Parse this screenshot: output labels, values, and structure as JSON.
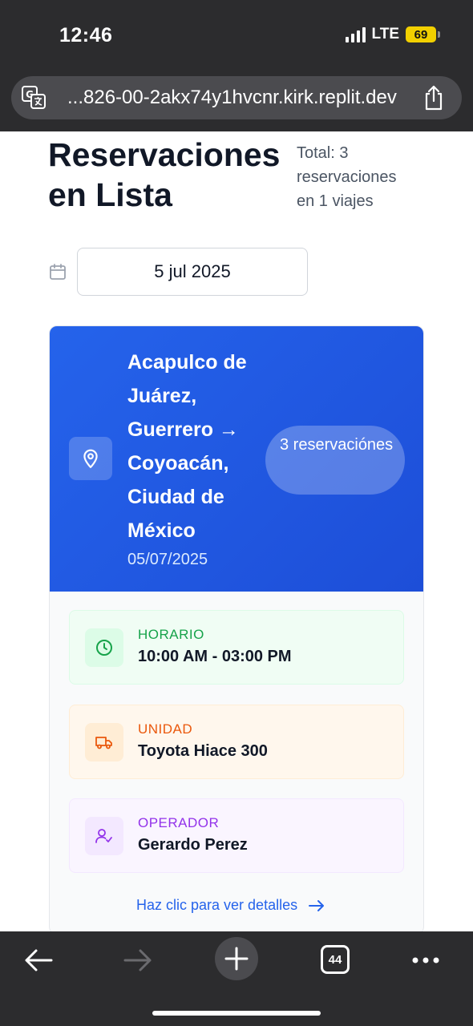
{
  "status_bar": {
    "time": "12:46",
    "network": "LTE",
    "battery": "69"
  },
  "browser": {
    "url": "...826-00-2akx74y1hvcnr.kirk.replit.dev",
    "tabs_count": "44"
  },
  "page": {
    "title": "Reservaciones en Lista",
    "summary": "Total: 3 reservaciones en 1 viajes",
    "date_value": "5 jul 2025"
  },
  "trip": {
    "route": "Acapulco de Juárez, Guerrero → Coyoacán, Ciudad de México",
    "date": "05/07/2025",
    "reservations_badge": "3 reservaciónes",
    "schedule_label": "HORARIO",
    "schedule_value": "10:00 AM - 03:00 PM",
    "unit_label": "UNIDAD",
    "unit_value": "Toyota Hiace 300",
    "operator_label": "OPERADOR",
    "operator_value": "Gerardo Perez",
    "details_link": "Haz clic para ver detalles"
  },
  "colors": {
    "header_blue": "#2563eb",
    "schedule_green": "#16a34a",
    "unit_orange": "#ea580c",
    "operator_purple": "#9333ea"
  },
  "icons": [
    "translate-icon",
    "share-icon",
    "calendar-icon",
    "location-pin-icon",
    "clock-icon",
    "truck-icon",
    "user-check-icon",
    "arrow-right-icon",
    "back-arrow-icon",
    "forward-arrow-icon",
    "plus-icon",
    "tabs-icon",
    "more-icon"
  ]
}
